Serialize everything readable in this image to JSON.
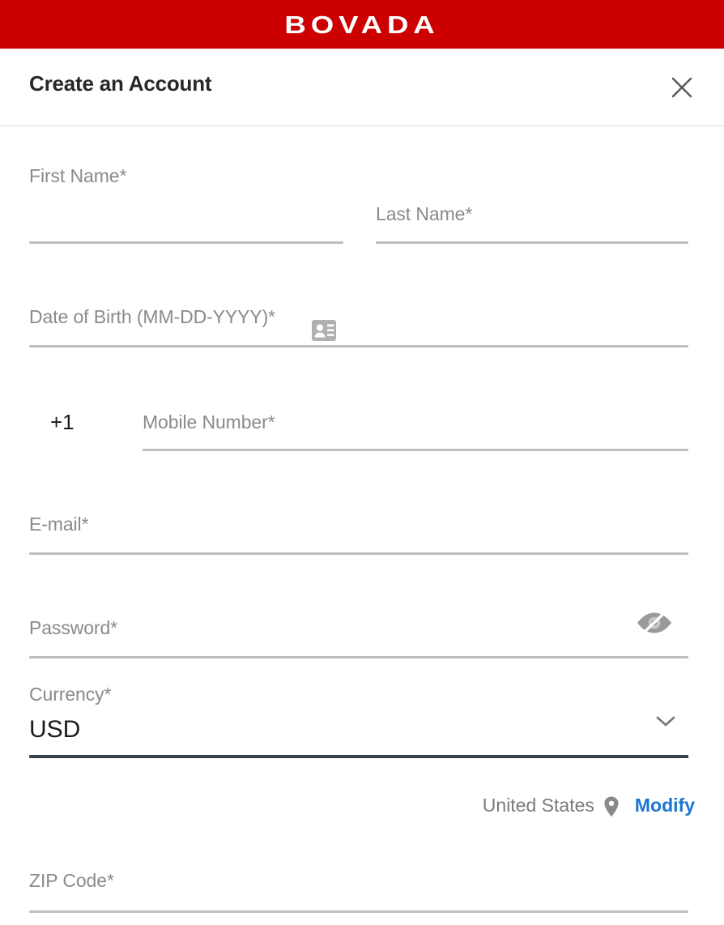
{
  "brand": {
    "logo_text": "BOVADA",
    "bar_color": "#cc0000"
  },
  "dialog": {
    "title": "Create an Account",
    "close_icon": "close-icon"
  },
  "form": {
    "fields": [
      {
        "key": "first_name",
        "label": "First Name*",
        "value": ""
      },
      {
        "key": "last_name",
        "label": "Last Name*",
        "value": ""
      },
      {
        "key": "date_of_birth",
        "label": "Date of Birth (MM-DD-YYYY)*",
        "value": ""
      },
      {
        "key": "mobile_number",
        "label": "Mobile Number*",
        "value": "",
        "prefix": "+1"
      },
      {
        "key": "email",
        "label": "E-mail*",
        "value": ""
      },
      {
        "key": "password",
        "label": "Password*",
        "value": ""
      },
      {
        "key": "currency",
        "label": "Currency*",
        "value": "USD"
      },
      {
        "key": "zip_code",
        "label": "ZIP Code*",
        "value": ""
      }
    ],
    "contact_picker_icon": "contact-card-icon",
    "password_toggle_icon": "eye-off-icon",
    "currency_dropdown_icon": "chevron-down-icon"
  },
  "location": {
    "country": "United States",
    "pin_icon": "map-pin-icon",
    "modify_label": "Modify",
    "link_color": "#1b75d0"
  },
  "colors": {
    "brand_red": "#cc0000",
    "label_gray": "#8a8a8a",
    "underline_gray": "#bfbfbf",
    "underline_active": "#36424c",
    "title_dark": "#26282b",
    "link_blue": "#1b75d0"
  }
}
